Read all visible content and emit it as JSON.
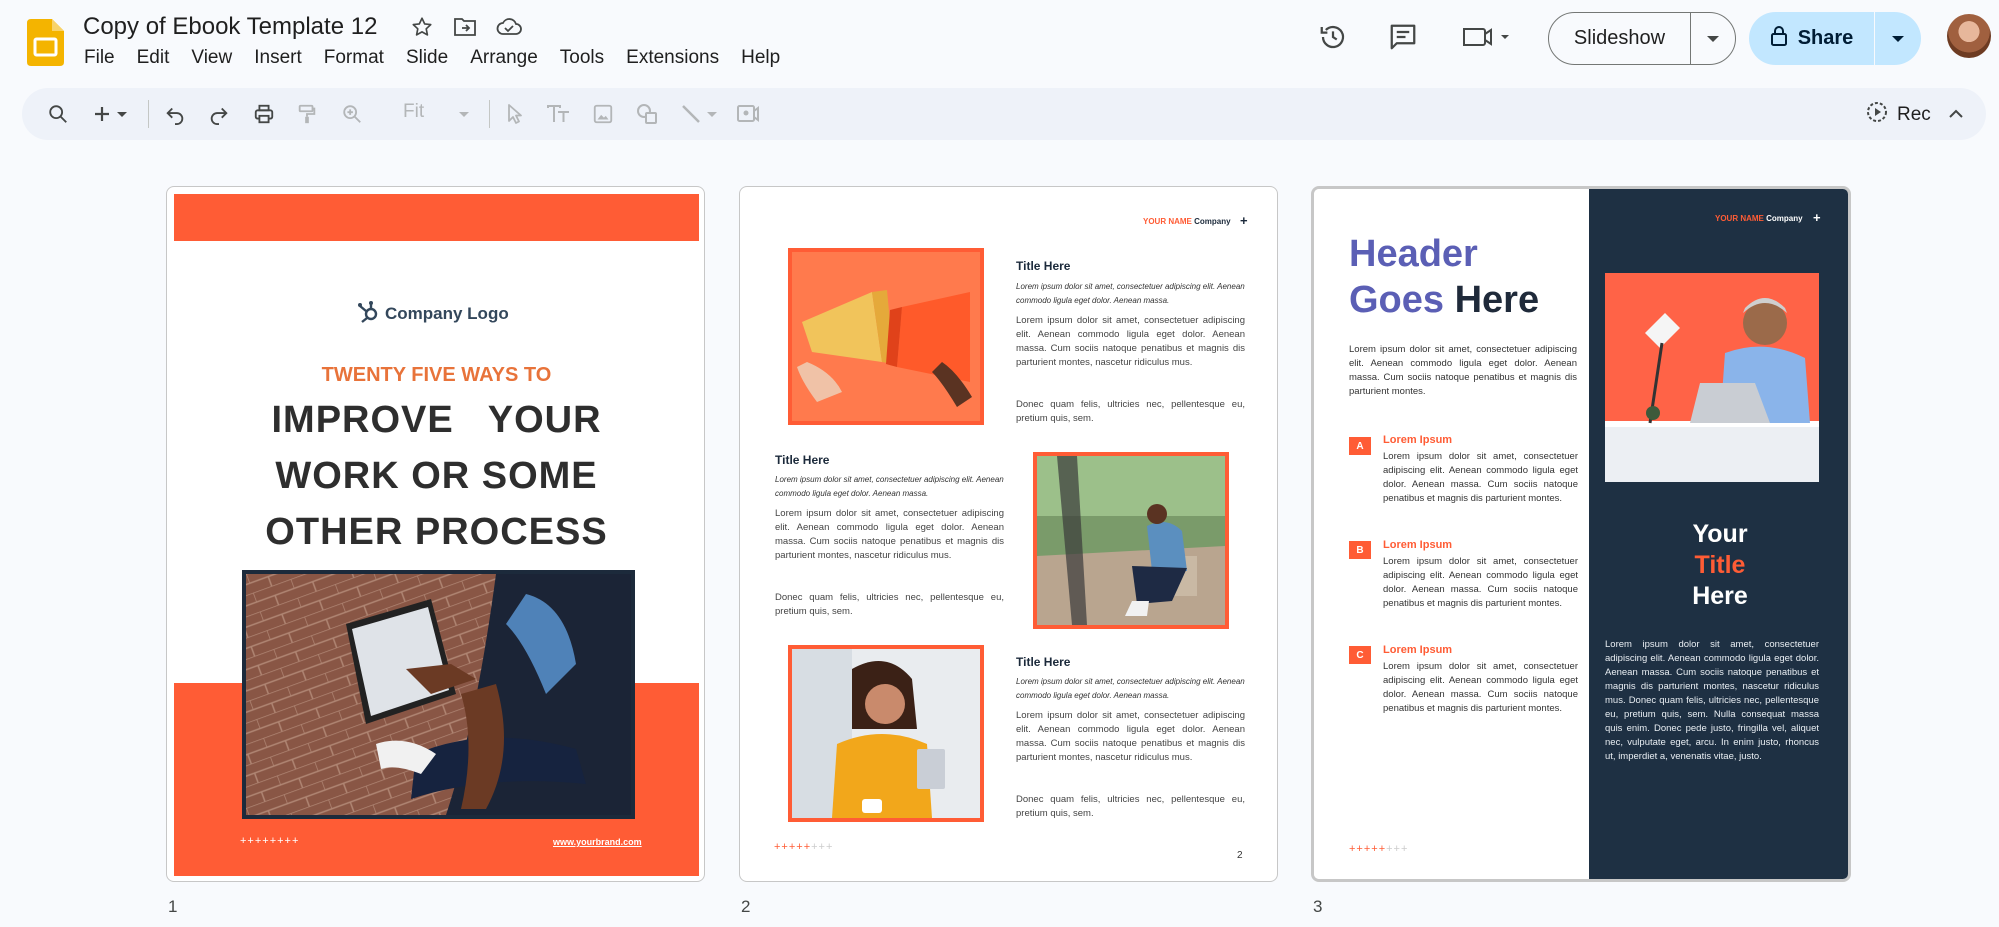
{
  "header": {
    "doc_title": "Copy of Ebook Template 12",
    "menu": [
      "File",
      "Edit",
      "View",
      "Insert",
      "Format",
      "Slide",
      "Arrange",
      "Tools",
      "Extensions",
      "Help"
    ],
    "slideshow_label": "Slideshow",
    "share_label": "Share"
  },
  "toolbar": {
    "zoom_value": "Fit",
    "rec_label": "Rec"
  },
  "slides": [
    {
      "number": "1",
      "logo_text": "Company Logo",
      "subtitle": "TWENTY FIVE WAYS TO",
      "title_line1": "IMPROVE   YOUR",
      "title_line2": "WORK OR SOME",
      "title_line3": "OTHER PROCESS",
      "stars": "++++++++",
      "link": "www.yourbrand.com"
    },
    {
      "number": "2",
      "brand_orange": "YOUR NAME",
      "brand_dark": " Company",
      "plus": "+",
      "blocks": [
        {
          "title": "Title Here",
          "italic": "Lorem ipsum dolor sit amet, consectetuer adipiscing elit. Aenean commodo ligula eget dolor. Aenean massa.",
          "body": "Lorem ipsum dolor sit amet, consectetuer adipiscing elit. Aenean commodo ligula eget dolor. Aenean massa. Cum sociis natoque penatibus et magnis dis parturient montes, nascetur ridiculus mus.",
          "body2": "Donec quam felis, ultricies nec, pellentesque eu, pretium quis, sem."
        },
        {
          "title": "Title Here",
          "italic": "Lorem ipsum dolor sit amet, consectetuer adipiscing elit. Aenean commodo ligula eget dolor. Aenean massa.",
          "body": "Lorem ipsum dolor sit amet, consectetuer adipiscing elit. Aenean commodo ligula eget dolor. Aenean massa. Cum sociis natoque penatibus et magnis dis parturient montes, nascetur ridiculus mus.",
          "body2": "Donec quam felis, ultricies nec, pellentesque eu, pretium quis, sem."
        },
        {
          "title": "Title Here",
          "italic": "Lorem ipsum dolor sit amet, consectetuer adipiscing elit. Aenean commodo ligula eget dolor. Aenean massa.",
          "body": "Lorem ipsum dolor sit amet, consectetuer adipiscing elit. Aenean commodo ligula eget dolor. Aenean massa. Cum sociis natoque penatibus et magnis dis parturient montes, nascetur ridiculus mus.",
          "body2": "Donec quam felis, ultricies nec, pellentesque eu, pretium quis, sem."
        }
      ],
      "stars_on": "+++++",
      "stars_off": "+++",
      "page": "2"
    },
    {
      "number": "3",
      "header_p1": "Header",
      "header_p2": "Goes",
      "header_p3": " Here",
      "intro": "Lorem ipsum dolor sit amet, consectetuer adipiscing elit. Aenean commodo ligula eget dolor. Aenean massa. Cum sociis natoque penatibus et magnis dis parturient montes.",
      "items": [
        {
          "badge": "A",
          "title": "Lorem Ipsum",
          "body": "Lorem ipsum dolor sit amet, consectetuer adipiscing elit. Aenean commodo ligula eget dolor. Aenean massa. Cum sociis natoque penatibus et magnis dis parturient montes."
        },
        {
          "badge": "B",
          "title": "Lorem Ipsum",
          "body": "Lorem ipsum dolor sit amet, consectetuer adipiscing elit. Aenean commodo ligula eget dolor. Aenean massa. Cum sociis natoque penatibus et magnis dis parturient montes."
        },
        {
          "badge": "C",
          "title": "Lorem Ipsum",
          "body": "Lorem ipsum dolor sit amet, consectetuer adipiscing elit. Aenean commodo ligula eget dolor. Aenean massa. Cum sociis natoque penatibus et magnis dis parturient montes."
        }
      ],
      "brand_orange": "YOUR NAME",
      "brand_light": " Company",
      "plus": "+",
      "your_l1": "Your",
      "your_l2": "Title",
      "your_l3": "Here",
      "body": "Lorem ipsum dolor sit amet, consectetuer adipiscing elit. Aenean commodo ligula eget dolor. Aenean massa. Cum sociis natoque penatibus et magnis dis parturient montes, nascetur ridiculus mus. Donec quam felis, ultricies nec, pellentesque eu, pretium quis, sem. Nulla consequat massa quis enim. Donec pede justo, fringilla vel, aliquet nec, vulputate eget, arcu. In enim justo, rhoncus ut, imperdiet a, venenatis vitae, justo.",
      "stars_on": "+++++",
      "stars_off": "+++"
    }
  ],
  "colors": {
    "accent": "#ff5c35",
    "navy": "#1e3043",
    "purple": "#5b5fb5",
    "share_bg": "#c2e7ff",
    "slides_yellow": "#f4b400"
  },
  "icons": [
    "slides-app-icon",
    "star-icon",
    "move-to-folder-icon",
    "cloud-saved-icon",
    "history-icon",
    "comment-icon",
    "video-call-icon",
    "lock-icon",
    "search-icon",
    "plus-icon",
    "undo-icon",
    "redo-icon",
    "print-icon",
    "paint-format-icon",
    "zoom-icon",
    "cursor-icon",
    "text-box-icon",
    "image-icon",
    "shape-icon",
    "line-icon",
    "comment-add-icon",
    "record-icon",
    "collapse-icon"
  ]
}
